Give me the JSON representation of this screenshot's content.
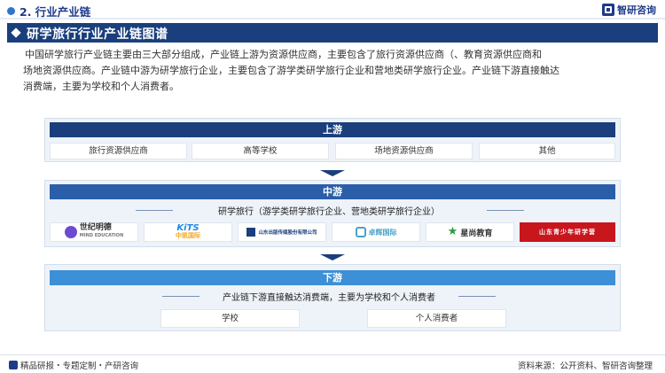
{
  "header": {
    "section": "2. 行业产业链",
    "brand": "智研咨询"
  },
  "banner": {
    "title": "研学旅行行业产业链图谱"
  },
  "intro": {
    "line1": "中国研学旅行产业链主要由三大部分组成，产业链上游为资源供应商，主要包含了旅行资源供应商（、教育资源供应商和",
    "line2": "场地资源供应商。产业链中游为研学旅行企业，主要包含了游学类研学旅行企业和营地类研学旅行企业。产业链下游直接触达",
    "line3": "消费端，主要为学校和个人消费者。"
  },
  "upstream": {
    "title": "上游",
    "items": [
      "旅行资源供应商",
      "高等学校",
      "场地资源供应商",
      "其他"
    ]
  },
  "midstream": {
    "title": "中游",
    "subtitle": "研学旅行（游学类研学旅行企业、营地类研学旅行企业）",
    "logos": [
      {
        "name": "世纪明德",
        "sub": "MIND EDUCATION",
        "color": "#333333",
        "accent": "#6c4bd1"
      },
      {
        "name": "KiTS",
        "sub": "中凯国际",
        "color": "#1e88e5",
        "accent": "#f5a623"
      },
      {
        "name": "山东出版传媒股份有限公司",
        "sub": "",
        "color": "#1a3f7c",
        "accent": "#1a3f7c"
      },
      {
        "name": "卓辉国际",
        "sub": "",
        "color": "#4aa3c8",
        "accent": "#4aa3c8"
      },
      {
        "name": "星尚教育",
        "sub": "",
        "color": "#333333",
        "accent": "#2e9b3f"
      },
      {
        "name": "山东青少年研学营",
        "sub": "",
        "color": "#ffffff",
        "accent": "#c8161d"
      }
    ]
  },
  "downstream": {
    "title": "下游",
    "subtitle": "产业链下游直接触达消费端，主要为学校和个人消费者",
    "items": [
      "学校",
      "个人消费者"
    ]
  },
  "footer": {
    "left": "精品研报・专题定制・产研咨询",
    "right": "资料来源：公开资料、智研咨询整理"
  },
  "colors": {
    "navy": "#1a3f7c",
    "mid_blue": "#2b5ea8",
    "light_blue": "#3d8fd8",
    "panel_bg": "#eef3f9"
  }
}
